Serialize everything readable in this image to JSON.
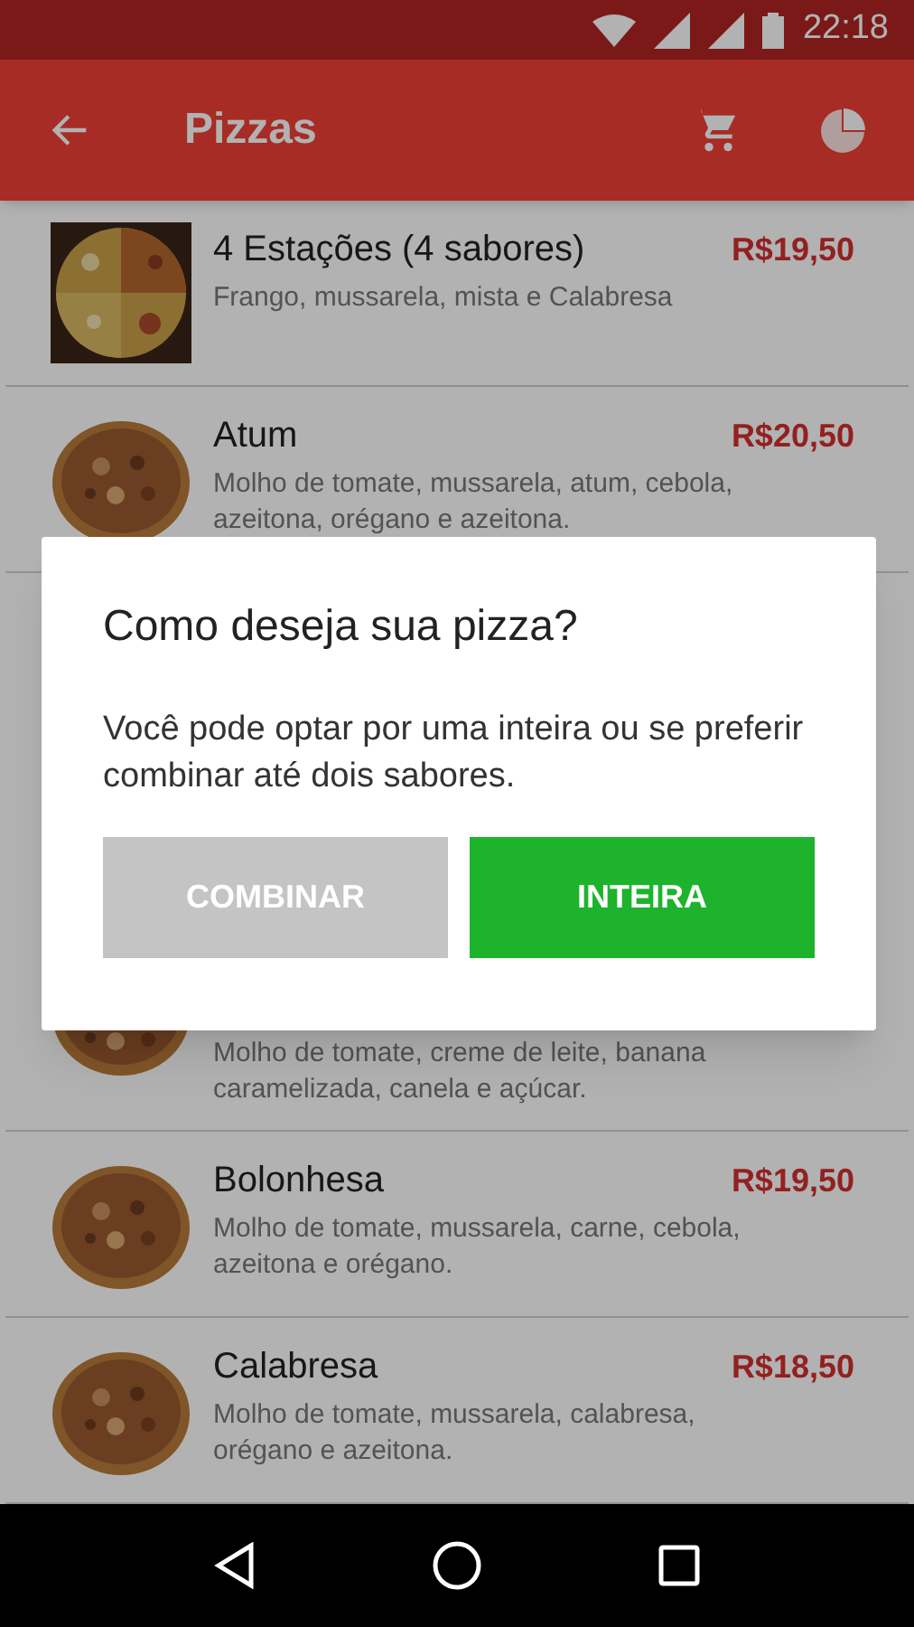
{
  "status_bar": {
    "time": "22:18"
  },
  "app_bar": {
    "title": "Pizzas"
  },
  "items_above_dialog": [
    {
      "name": "4 Estações (4 sabores)",
      "price": "R$19,50",
      "description": "Frango, mussarela, mista e Calabresa",
      "kind": "square"
    },
    {
      "name": "Atum",
      "price": "R$20,50",
      "description": "Molho de tomate, mussarela, atum, cebola, azeitona, orégano e azeitona.",
      "kind": "round"
    }
  ],
  "items_below_dialog": [
    {
      "description": "Molho de tomate, creme de leite, banana caramelizada, canela e açúcar.",
      "kind": "round"
    },
    {
      "name": "Bolonhesa",
      "price": "R$19,50",
      "description": "Molho de tomate, mussarela, carne, cebola, azeitona e orégano.",
      "kind": "round"
    },
    {
      "name": "Calabresa",
      "price": "R$18,50",
      "description": "Molho de tomate, mussarela, calabresa, orégano e azeitona.",
      "kind": "round"
    }
  ],
  "dialog": {
    "title": "Como deseja sua pizza?",
    "message": "Você pode optar por uma inteira ou se preferir combinar até dois sabores.",
    "buttons": [
      {
        "label": "COMBINAR",
        "kind": "secondary"
      },
      {
        "label": "INTEIRA",
        "kind": "primary"
      }
    ]
  }
}
